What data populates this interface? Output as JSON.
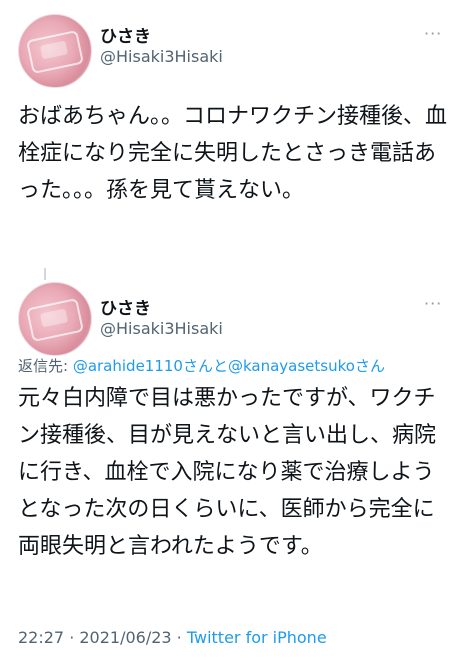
{
  "tweet1": {
    "name": "ひさき",
    "handle": "@Hisaki3Hisaki",
    "more": "···",
    "text": "おばあちゃん。。コロナワクチン接種後、血栓症になり完全に失明したとさっき電話あった。。。孫を見て貰えない。"
  },
  "tweet2": {
    "name": "ひさき",
    "handle": "@Hisaki3Hisaki",
    "more": "···",
    "reply_prefix": "返信先: ",
    "mention1": "@arahide1110さんと",
    "mention2": "@kanayasetsukoさん",
    "text": "元々白内障で目は悪かったですが、ワクチン接種後、目が見えないと言い出し、病院に行き、血栓で入院になり薬で治療しようとなった次の日くらいに、医師から完全に両眼失明と言われたようです。",
    "time": "22:27",
    "separator": " · ",
    "date": "2021/06/23",
    "source": "Twitter for iPhone"
  }
}
